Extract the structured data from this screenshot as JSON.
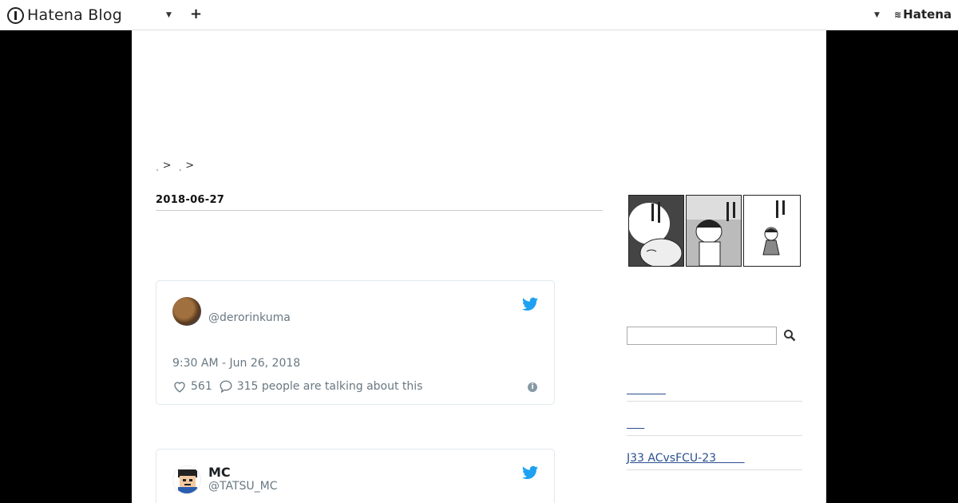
{
  "topbar": {
    "logo_text": "Hatena Blog",
    "add_label": "+",
    "brand_label": "Hatena"
  },
  "breadcrumb": [
    {
      "label": ">"
    },
    {
      "label": ">"
    }
  ],
  "entry": {
    "date": "2018-06-27"
  },
  "tweets": [
    {
      "handle": "@derorinkuma",
      "time": "9:30 AM - Jun 26, 2018",
      "likes": "561",
      "talking": "315 people are talking about this"
    },
    {
      "name": "MC",
      "handle": "@TATSU_MC"
    }
  ],
  "sidebar": {
    "search_placeholder": "",
    "links": [
      {
        "label": "           "
      },
      {
        "label": "     "
      },
      {
        "label": "J33 ACvsFCU-23        "
      }
    ]
  },
  "colors": {
    "twitter_blue": "#1da1f2",
    "link": "#2a4f8f",
    "page_bg": "#000000"
  }
}
